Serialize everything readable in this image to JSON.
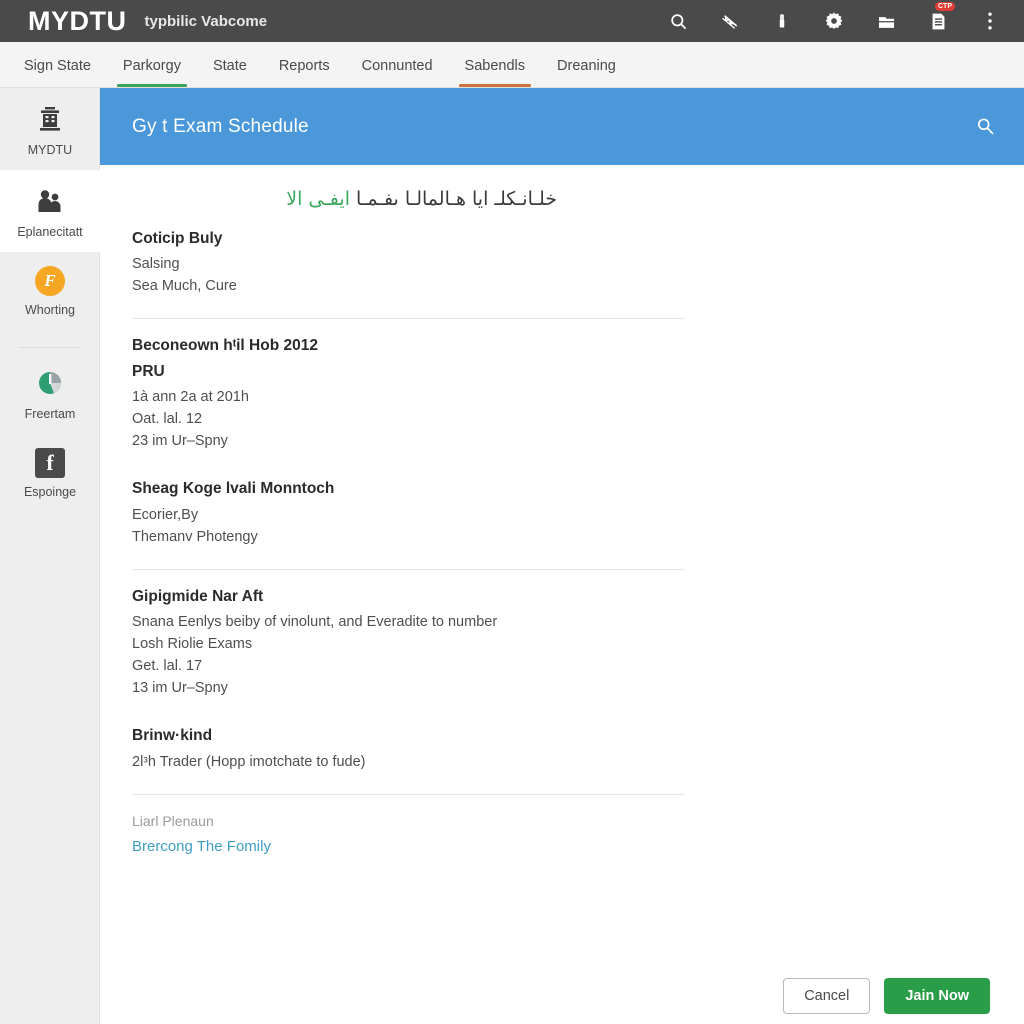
{
  "topbar": {
    "brand": "MYDTU",
    "subtitle": "typbilic Vabcome",
    "icons": [
      {
        "name": "search-icon",
        "label": "Search"
      },
      {
        "name": "notifications-off-icon",
        "label": "Notifications Off"
      },
      {
        "name": "lock-icon",
        "label": "Lock"
      },
      {
        "name": "gear-icon",
        "label": "Settings"
      },
      {
        "name": "folder-icon",
        "label": "Files"
      },
      {
        "name": "document-icon",
        "label": "Documents",
        "badge": "CTP"
      },
      {
        "name": "more-vertical-icon",
        "label": "More"
      }
    ]
  },
  "tabs": [
    {
      "label": "Sign State",
      "active": false,
      "underline": ""
    },
    {
      "label": "Parkorgy",
      "active": true,
      "underline": "#3da35d"
    },
    {
      "label": "State",
      "active": false,
      "underline": ""
    },
    {
      "label": "Reports",
      "active": false,
      "underline": ""
    },
    {
      "label": "Connunted",
      "active": false,
      "underline": ""
    },
    {
      "label": "Sabendls",
      "active": true,
      "underline": "#c9733f"
    },
    {
      "label": "Dreaning",
      "active": false,
      "underline": ""
    }
  ],
  "sidebar": {
    "items": [
      {
        "label": "MYDTU",
        "icon": "building-icon",
        "active": false
      },
      {
        "label": "Eplanecitatt",
        "icon": "people-icon",
        "active": true
      },
      {
        "label": "Whorting",
        "icon": "orange-badge-icon",
        "glyph": "F",
        "active": false
      },
      {
        "label": "Freertam",
        "icon": "pie-chart-icon",
        "active": false
      },
      {
        "label": "Espoinge",
        "icon": "facebook-icon",
        "glyph": "f",
        "active": false
      }
    ]
  },
  "page": {
    "title": "Gy t Exam Schedule",
    "search_icon": "search-icon",
    "header_color": "#4a97d9"
  },
  "content": {
    "arabic_highlight": "ايفـى الا",
    "arabic_rest": "خلـانـكلـ ايا هـالمالـا ىفـمـا",
    "sections": [
      {
        "title": "Coticip Buly",
        "subtitle": "",
        "lines": [
          "Salsing",
          "Sea Much, Cure"
        ],
        "divider_after": true
      },
      {
        "title": "Beconeown hᵗil Hob 2012",
        "subtitle": "PRU",
        "lines": [
          "1à ann 2a at 201h",
          "Oat. lal. 12",
          "23 im Ur–Spny"
        ],
        "divider_after": false
      },
      {
        "title": "Sheag Koge lvali Monntoch",
        "subtitle": "",
        "lines": [
          "Ecorier,By",
          "Themanv Photengy"
        ],
        "divider_after": true
      },
      {
        "title": "Gipigmide Nar Aft",
        "subtitle": "",
        "lines": [
          "Snana Eenlys beiby of vinolunt, and Everadite to number",
          "Losh Riolie Exams",
          "Get. lal. 17",
          "13 im Ur–Spny"
        ],
        "divider_after": false
      },
      {
        "title": "Brinw·kind",
        "subtitle": "",
        "lines": [
          "2lᵌh Trader (Hopp imotchate to fude)"
        ],
        "divider_after": true
      }
    ],
    "footer_label": "Liarl Plenaun",
    "footer_link": "Brercong The Fomily"
  },
  "actions": {
    "cancel_label": "Cancel",
    "join_label": "Jain Now",
    "join_color": "#2a9d48"
  }
}
